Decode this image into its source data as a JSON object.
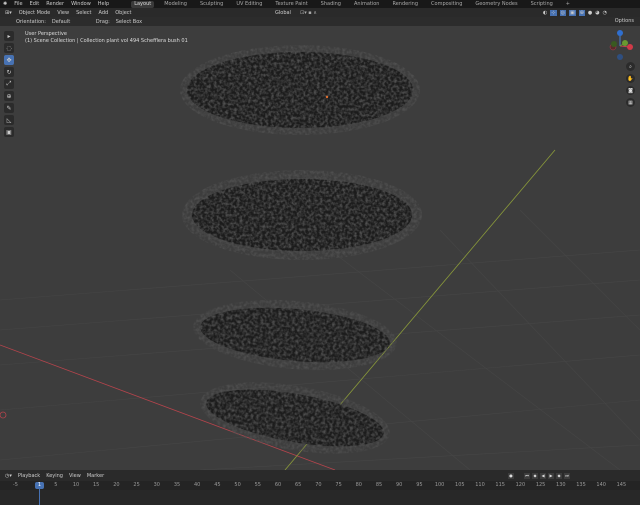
{
  "menu": {
    "items": [
      "File",
      "Edit",
      "Render",
      "Window",
      "Help"
    ]
  },
  "workspaces": [
    "Layout",
    "Modeling",
    "Sculpting",
    "UV Editing",
    "Texture Paint",
    "Shading",
    "Animation",
    "Rendering",
    "Compositing",
    "Geometry Nodes",
    "Scripting",
    "+"
  ],
  "header": {
    "mode": "Object Mode",
    "view": "View",
    "select": "Select",
    "add": "Add",
    "object": "Object",
    "transform_orientation": "Global"
  },
  "tool_settings": {
    "orientation_label": "Orientation:",
    "orientation": "Default",
    "drag_label": "Drag:",
    "drag": "Select Box",
    "options": "Options"
  },
  "viewport": {
    "perspective": "User Perspective",
    "collection": "(1) Scene Collection | Collection plant vol 494 Schefflera bush 01"
  },
  "timeline": {
    "playback": "Playback",
    "keying": "Keying",
    "view": "View",
    "marker": "Marker",
    "current_frame": "1",
    "ticks": [
      "-5",
      "5",
      "10",
      "15",
      "20",
      "25",
      "30",
      "35",
      "40",
      "45",
      "50",
      "55",
      "60",
      "65",
      "70",
      "75",
      "80",
      "85",
      "90",
      "95",
      "100",
      "105",
      "110",
      "115",
      "120",
      "125",
      "130",
      "135",
      "140",
      "145"
    ],
    "tick_frames": [
      -5,
      5,
      10,
      15,
      20,
      25,
      30,
      35,
      40,
      45,
      50,
      55,
      60,
      65,
      70,
      75,
      80,
      85,
      90,
      95,
      100,
      105,
      110,
      115,
      120,
      125,
      130,
      135,
      140,
      145
    ]
  },
  "colors": {
    "accent": "#4772b3",
    "x_axis": "#b5444c",
    "y_axis": "#8a9a3a"
  }
}
